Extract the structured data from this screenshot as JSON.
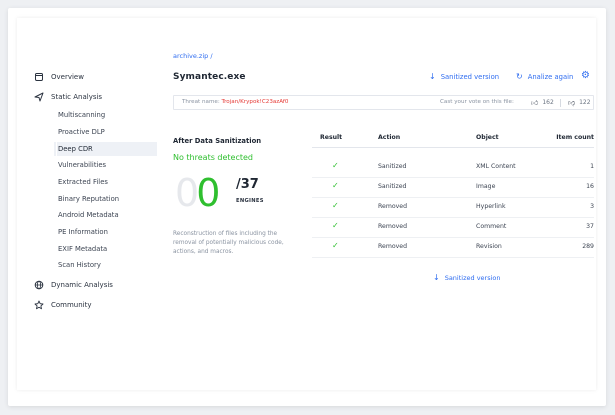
{
  "sidebar": {
    "overview": "Overview",
    "static_analysis": "Static Analysis",
    "sub_items": [
      "Multiscanning",
      "Proactive DLP",
      "Deep CDR",
      "Vulnerabilities",
      "Extracted Files",
      "Binary Reputation",
      "Android Metadata",
      "PE Information",
      "EXIF Metadata",
      "Scan History"
    ],
    "active_item": "Deep CDR",
    "dynamic_analysis": "Dynamic Analysis",
    "community": "Community"
  },
  "header": {
    "breadcrumb": "archive.zip /",
    "file_name": "Symantec.exe",
    "sanitized_btn": "Sanitized version",
    "analyze_btn": "Analize again"
  },
  "threat": {
    "label": "Threat name:",
    "value": "Trojan/Krypok!C23azAf0",
    "vote_label": "Cast your vote on this file:",
    "upvotes": "162",
    "downvotes": "122"
  },
  "summary": {
    "title": "After Data Sanitization",
    "status": "No threats detected",
    "ghost_digit": "0",
    "detected": "0",
    "total": "/37",
    "engines_label": "ENGINES",
    "description": "Reconstruction of files including the removal of potentially malicious code, actions, and macros."
  },
  "table": {
    "headers": {
      "result": "Result",
      "action": "Action",
      "object": "Object",
      "count": "Item count"
    },
    "rows": [
      {
        "action": "Sanitized",
        "object": "XML Content",
        "count": "1"
      },
      {
        "action": "Sanitized",
        "object": "Image",
        "count": "16"
      },
      {
        "action": "Removed",
        "object": "Hyperlink",
        "count": "3"
      },
      {
        "action": "Removed",
        "object": "Comment",
        "count": "37"
      },
      {
        "action": "Removed",
        "object": "Revision",
        "count": "289"
      }
    ]
  },
  "bottom_link": "Sanitized version",
  "colors": {
    "accent": "#2f6df0",
    "success": "#2fbf2f",
    "danger": "#e53935"
  }
}
